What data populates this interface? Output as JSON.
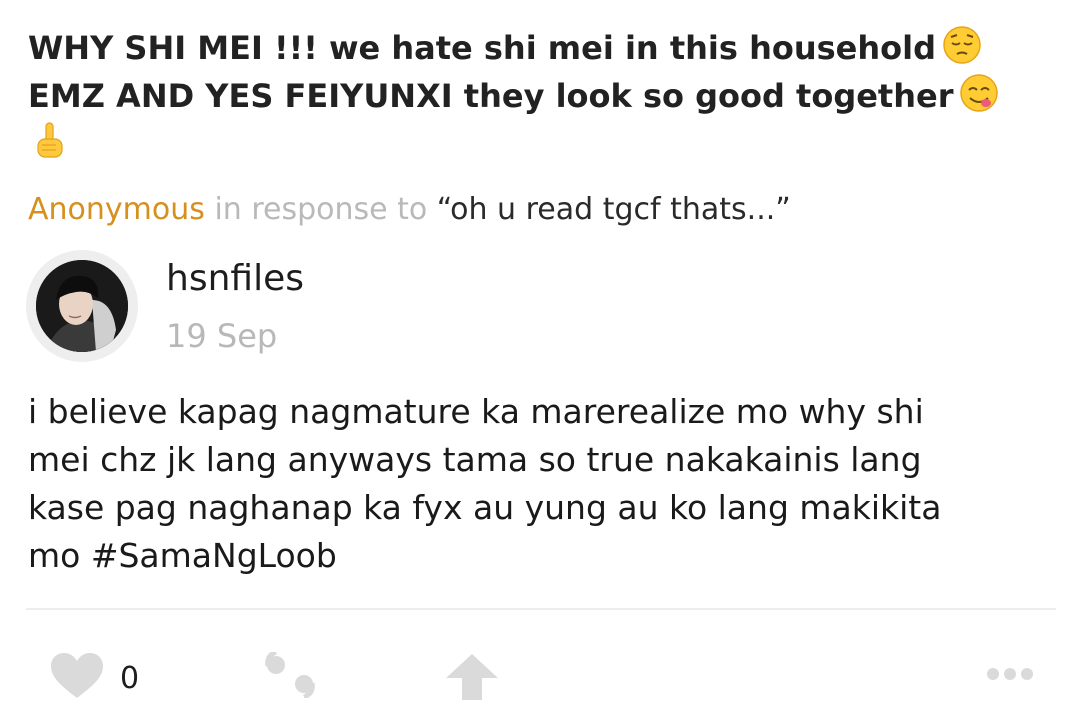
{
  "question": {
    "line1": "WHY SHI MEI !!! we hate shi mei in this household",
    "line1_emoji": "pensive-face-emoji",
    "line2": "EMZ AND YES FEIYUNXI they look so good together",
    "line2_emoji": "savoring-food-face-emoji",
    "line3_emoji": "pointing-up-hand-emoji"
  },
  "attribution": {
    "asker": "Anonymous",
    "connector": "in response to",
    "quoted": "“oh u read tgcf thats...”"
  },
  "answerer": {
    "username": "hsnfiles",
    "date": "19 Sep"
  },
  "answer": {
    "lines": [
      "i believe kapag nagmature ka marerealize mo why shi",
      "mei chz jk lang anyways tama so true nakakainis lang",
      "kase pag naghanap ka fyx au yung au ko lang makikita",
      "mo #SamaNgLoob"
    ]
  },
  "actions": {
    "like_icon": "heart-icon",
    "like_count": "0",
    "quote_icon": "quote-icon",
    "share_icon": "share-arrow-icon",
    "more_icon": "more-dots-icon"
  },
  "colors": {
    "asker": "#d6901e",
    "muted": "#b8b8b8",
    "icon_gray": "#dadada"
  }
}
